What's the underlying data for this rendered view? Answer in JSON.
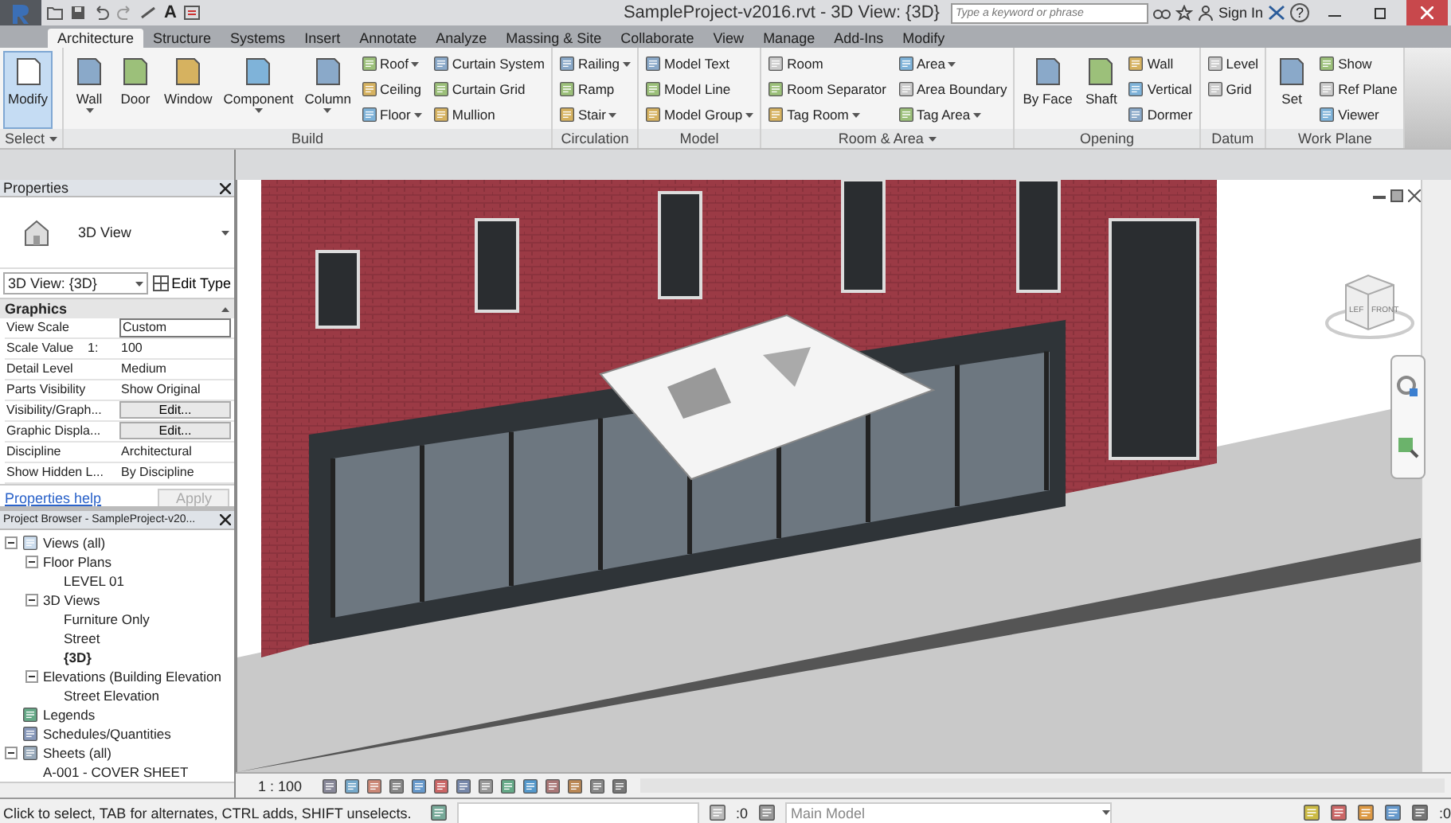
{
  "title_bar": {
    "title": "SampleProject-v2016.rvt - 3D View: {3D}",
    "text_tool": "A",
    "search": {
      "placeholder": "Type a keyword or phrase"
    },
    "sign_in": "Sign In",
    "help": "?"
  },
  "tabs": [
    {
      "label": "Architecture",
      "selected": true
    },
    {
      "label": "Structure",
      "selected": false
    },
    {
      "label": "Systems",
      "selected": false
    },
    {
      "label": "Insert",
      "selected": false
    },
    {
      "label": "Annotate",
      "selected": false
    },
    {
      "label": "Analyze",
      "selected": false
    },
    {
      "label": "Massing & Site",
      "selected": false
    },
    {
      "label": "Collaborate",
      "selected": false
    },
    {
      "label": "View",
      "selected": false
    },
    {
      "label": "Manage",
      "selected": false
    },
    {
      "label": "Add-Ins",
      "selected": false
    },
    {
      "label": "Modify",
      "selected": false
    }
  ],
  "ribbon": {
    "panels": [
      {
        "title": "Select",
        "menu": true,
        "tools": [
          {
            "label": "Modify",
            "kind": "large",
            "dropdown": false,
            "disabled": false,
            "active": true
          }
        ]
      },
      {
        "title": "Build",
        "menu": false,
        "tools": [
          {
            "label": "Wall",
            "kind": "large",
            "dropdown": true,
            "disabled": false,
            "active": false
          },
          {
            "label": "Door",
            "kind": "large",
            "dropdown": false,
            "disabled": false,
            "active": false
          },
          {
            "label": "Window",
            "kind": "large",
            "dropdown": false,
            "disabled": false,
            "active": false
          },
          {
            "label": "Component",
            "kind": "large",
            "dropdown": true,
            "disabled": false,
            "active": false
          },
          {
            "label": "Column",
            "kind": "large",
            "dropdown": true,
            "disabled": false,
            "active": false
          },
          {
            "label": "Roof",
            "kind": "small",
            "dropdown": true,
            "disabled": false,
            "active": false
          },
          {
            "label": "Ceiling",
            "kind": "small",
            "dropdown": false,
            "disabled": false,
            "active": false
          },
          {
            "label": "Floor",
            "kind": "small",
            "dropdown": true,
            "disabled": false,
            "active": false
          },
          {
            "label": "Curtain System",
            "kind": "small",
            "dropdown": false,
            "disabled": false,
            "active": false
          },
          {
            "label": "Curtain Grid",
            "kind": "small",
            "dropdown": false,
            "disabled": false,
            "active": false
          },
          {
            "label": "Mullion",
            "kind": "small",
            "dropdown": false,
            "disabled": false,
            "active": false
          }
        ]
      },
      {
        "title": "Circulation",
        "menu": false,
        "tools": [
          {
            "label": "Railing",
            "kind": "small",
            "dropdown": true,
            "disabled": false,
            "active": false
          },
          {
            "label": "Ramp",
            "kind": "small",
            "dropdown": false,
            "disabled": false,
            "active": false
          },
          {
            "label": "Stair",
            "kind": "small",
            "dropdown": true,
            "disabled": false,
            "active": false
          }
        ]
      },
      {
        "title": "Model",
        "menu": false,
        "tools": [
          {
            "label": "Model Text",
            "kind": "small",
            "dropdown": false,
            "disabled": false,
            "active": false
          },
          {
            "label": "Model Line",
            "kind": "small",
            "dropdown": false,
            "disabled": false,
            "active": false
          },
          {
            "label": "Model Group",
            "kind": "small",
            "dropdown": true,
            "disabled": false,
            "active": false
          }
        ]
      },
      {
        "title": "Room & Area",
        "menu": true,
        "tools": [
          {
            "label": "Room",
            "kind": "small",
            "dropdown": false,
            "disabled": true,
            "active": false
          },
          {
            "label": "Room Separator",
            "kind": "small",
            "dropdown": false,
            "disabled": false,
            "active": false
          },
          {
            "label": "Tag Room",
            "kind": "small",
            "dropdown": true,
            "disabled": false,
            "active": false
          },
          {
            "label": "Area",
            "kind": "small",
            "dropdown": true,
            "disabled": false,
            "active": false
          },
          {
            "label": "Area Boundary",
            "kind": "small",
            "dropdown": false,
            "disabled": true,
            "active": false
          },
          {
            "label": "Tag Area",
            "kind": "small",
            "dropdown": true,
            "disabled": false,
            "active": false
          }
        ]
      },
      {
        "title": "Opening",
        "menu": false,
        "tools": [
          {
            "label": "By Face",
            "kind": "large",
            "dropdown": false,
            "disabled": false,
            "active": false
          },
          {
            "label": "Shaft",
            "kind": "large",
            "dropdown": false,
            "disabled": false,
            "active": false
          },
          {
            "label": "Wall",
            "kind": "small",
            "dropdown": false,
            "disabled": false,
            "active": false
          },
          {
            "label": "Vertical",
            "kind": "small",
            "dropdown": false,
            "disabled": false,
            "active": false
          },
          {
            "label": "Dormer",
            "kind": "small",
            "dropdown": false,
            "disabled": false,
            "active": false
          }
        ]
      },
      {
        "title": "Datum",
        "menu": false,
        "tools": [
          {
            "label": "Level",
            "kind": "small",
            "dropdown": false,
            "disabled": true,
            "active": false
          },
          {
            "label": "Grid",
            "kind": "small",
            "dropdown": false,
            "disabled": true,
            "active": false
          }
        ]
      },
      {
        "title": "Work Plane",
        "menu": false,
        "tools": [
          {
            "label": "Set",
            "kind": "large",
            "dropdown": false,
            "disabled": false,
            "active": false
          },
          {
            "label": "Show",
            "kind": "small",
            "dropdown": false,
            "disabled": false,
            "active": false
          },
          {
            "label": "Ref Plane",
            "kind": "small",
            "dropdown": false,
            "disabled": true,
            "active": false
          },
          {
            "label": "Viewer",
            "kind": "small",
            "dropdown": false,
            "disabled": false,
            "active": false
          }
        ]
      }
    ]
  },
  "properties": {
    "title": "Properties",
    "type_name": "3D View",
    "view_selector": "3D View: {3D}",
    "edit_type": "Edit Type",
    "group": "Graphics",
    "rows": [
      {
        "label": "View Scale",
        "value": "Custom",
        "kind": "field"
      },
      {
        "label": "Scale Value    1:",
        "value": "100",
        "kind": "text"
      },
      {
        "label": "Detail Level",
        "value": "Medium",
        "kind": "text"
      },
      {
        "label": "Parts Visibility",
        "value": "Show Original",
        "kind": "text"
      },
      {
        "label": "Visibility/Graph...",
        "value": "Edit...",
        "kind": "button"
      },
      {
        "label": "Graphic Displa...",
        "value": "Edit...",
        "kind": "button"
      },
      {
        "label": "Discipline",
        "value": "Architectural",
        "kind": "text"
      },
      {
        "label": "Show Hidden L...",
        "value": "By Discipline",
        "kind": "text"
      }
    ],
    "help": "Properties help",
    "apply": "Apply"
  },
  "project_browser": {
    "title": "Project Browser - SampleProject-v20...",
    "tree": [
      {
        "label": "Views (all)",
        "expanded": true,
        "current": false,
        "children": [
          {
            "label": "Floor Plans",
            "expanded": true,
            "current": false,
            "children": [
              {
                "label": "LEVEL 01",
                "current": false
              }
            ]
          },
          {
            "label": "3D Views",
            "expanded": true,
            "current": false,
            "children": [
              {
                "label": "Furniture Only",
                "current": false
              },
              {
                "label": "Street",
                "current": false
              },
              {
                "label": "{3D}",
                "current": true
              }
            ]
          },
          {
            "label": "Elevations (Building Elevation",
            "expanded": true,
            "current": false,
            "children": [
              {
                "label": "Street Elevation",
                "current": false
              }
            ]
          }
        ]
      },
      {
        "label": "Legends",
        "current": false
      },
      {
        "label": "Schedules/Quantities",
        "current": false
      },
      {
        "label": "Sheets (all)",
        "expanded": true,
        "current": false,
        "children": [
          {
            "label": "A-001 - COVER SHEET",
            "current": false
          }
        ]
      }
    ]
  },
  "view_cube": {
    "left": "LEF",
    "front": "FRONT"
  },
  "view_bar": {
    "scale": "1 : 100"
  },
  "status_bar": {
    "message": "Click to select, TAB for alternates, CTRL adds, SHIFT unselects.",
    "selection_count": ":0",
    "model": "Main Model",
    "filter_count": ":0"
  }
}
